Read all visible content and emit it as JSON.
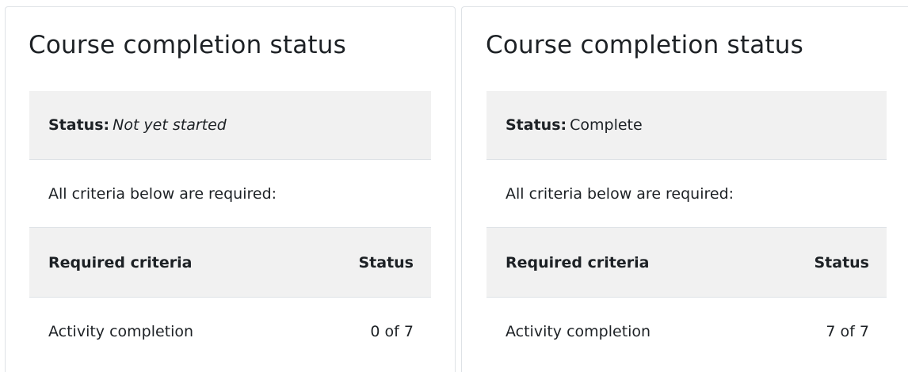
{
  "panels": [
    {
      "title": "Course completion status",
      "status_label": "Status:",
      "status_value": "Not yet started",
      "requirement_note": "All criteria below are required:",
      "table": {
        "headers": [
          "Required criteria",
          "Status"
        ],
        "rows": [
          {
            "criteria": "Activity completion",
            "status": "0 of 7"
          }
        ]
      }
    },
    {
      "title": "Course completion status",
      "status_label": "Status:",
      "status_value": "Complete",
      "requirement_note": "All criteria below are required:",
      "table": {
        "headers": [
          "Required criteria",
          "Status"
        ],
        "rows": [
          {
            "criteria": "Activity completion",
            "status": "7 of 7"
          }
        ]
      }
    }
  ],
  "colors": {
    "border": "#dee2e6",
    "shaded_row": "#f1f1f1",
    "text": "#1d2125"
  }
}
